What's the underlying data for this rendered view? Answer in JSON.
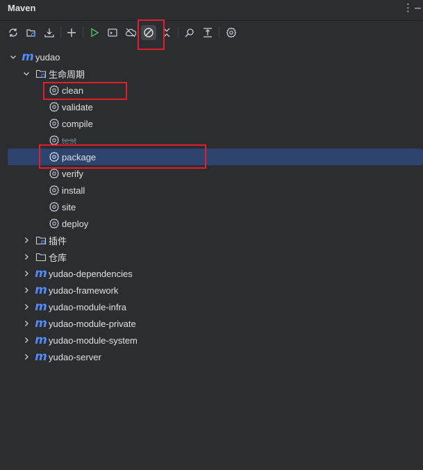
{
  "panel": {
    "title": "Maven"
  },
  "toolbar": {
    "icons": [
      "reload-icon",
      "generate-sources-icon",
      "download-icon",
      "add-icon",
      "run-icon",
      "execute-goal-icon",
      "offline-icon",
      "skip-tests-icon",
      "collapse-icon",
      "analyze-icon",
      "show-dependencies-icon",
      "settings-icon"
    ]
  },
  "tree": {
    "root": {
      "label": "yudao"
    },
    "lifecycle": {
      "label": "生命周期"
    },
    "goals": [
      "clean",
      "validate",
      "compile",
      "test",
      "package",
      "verify",
      "install",
      "site",
      "deploy"
    ],
    "plugins": {
      "label": "插件"
    },
    "repos": {
      "label": "仓库"
    },
    "modules": [
      "yudao-dependencies",
      "yudao-framework",
      "yudao-module-infra",
      "yudao-module-private",
      "yudao-module-system",
      "yudao-server"
    ]
  },
  "colors": {
    "background": "#2b2d30",
    "selection": "#2e436e",
    "accent": "#548af7",
    "highlight": "#e0202a"
  }
}
